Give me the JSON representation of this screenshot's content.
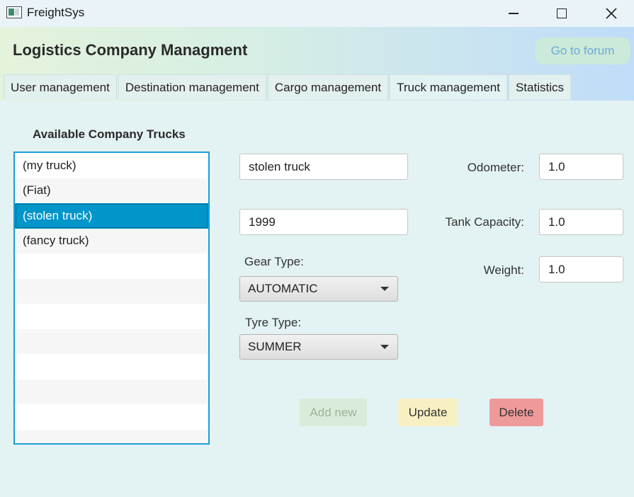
{
  "window": {
    "title": "FreightSys",
    "app_icon": "app-window-icon"
  },
  "header": {
    "heading": "Logistics Company Managment",
    "forum_button": "Go to forum"
  },
  "tabs": [
    {
      "label": "User management"
    },
    {
      "label": "Destination management"
    },
    {
      "label": "Cargo management"
    },
    {
      "label": "Truck management",
      "active": true
    },
    {
      "label": "Statistics"
    }
  ],
  "trucks": {
    "title": "Available Company Trucks",
    "items": [
      "(my  truck)",
      "(Fiat)",
      "(stolen truck)",
      "(fancy truck)"
    ],
    "selected_index": 2
  },
  "form": {
    "name_value": "stolen truck",
    "year_value": "1999",
    "gear_label": "Gear Type:",
    "gear_value": "AUTOMATIC",
    "tyre_label": "Tyre Type:",
    "tyre_value": "SUMMER",
    "odometer_label": "Odometer:",
    "odometer_value": "1.0",
    "tank_label": "Tank Capacity:",
    "tank_value": "1.0",
    "weight_label": "Weight:",
    "weight_value": "1.0"
  },
  "actions": {
    "add_label": "Add new",
    "update_label": "Update",
    "delete_label": "Delete"
  },
  "colors": {
    "selection": "#0096c9",
    "delete": "#ef9a9a",
    "update": "#f8f0c3",
    "add": "#d9ecd9"
  }
}
